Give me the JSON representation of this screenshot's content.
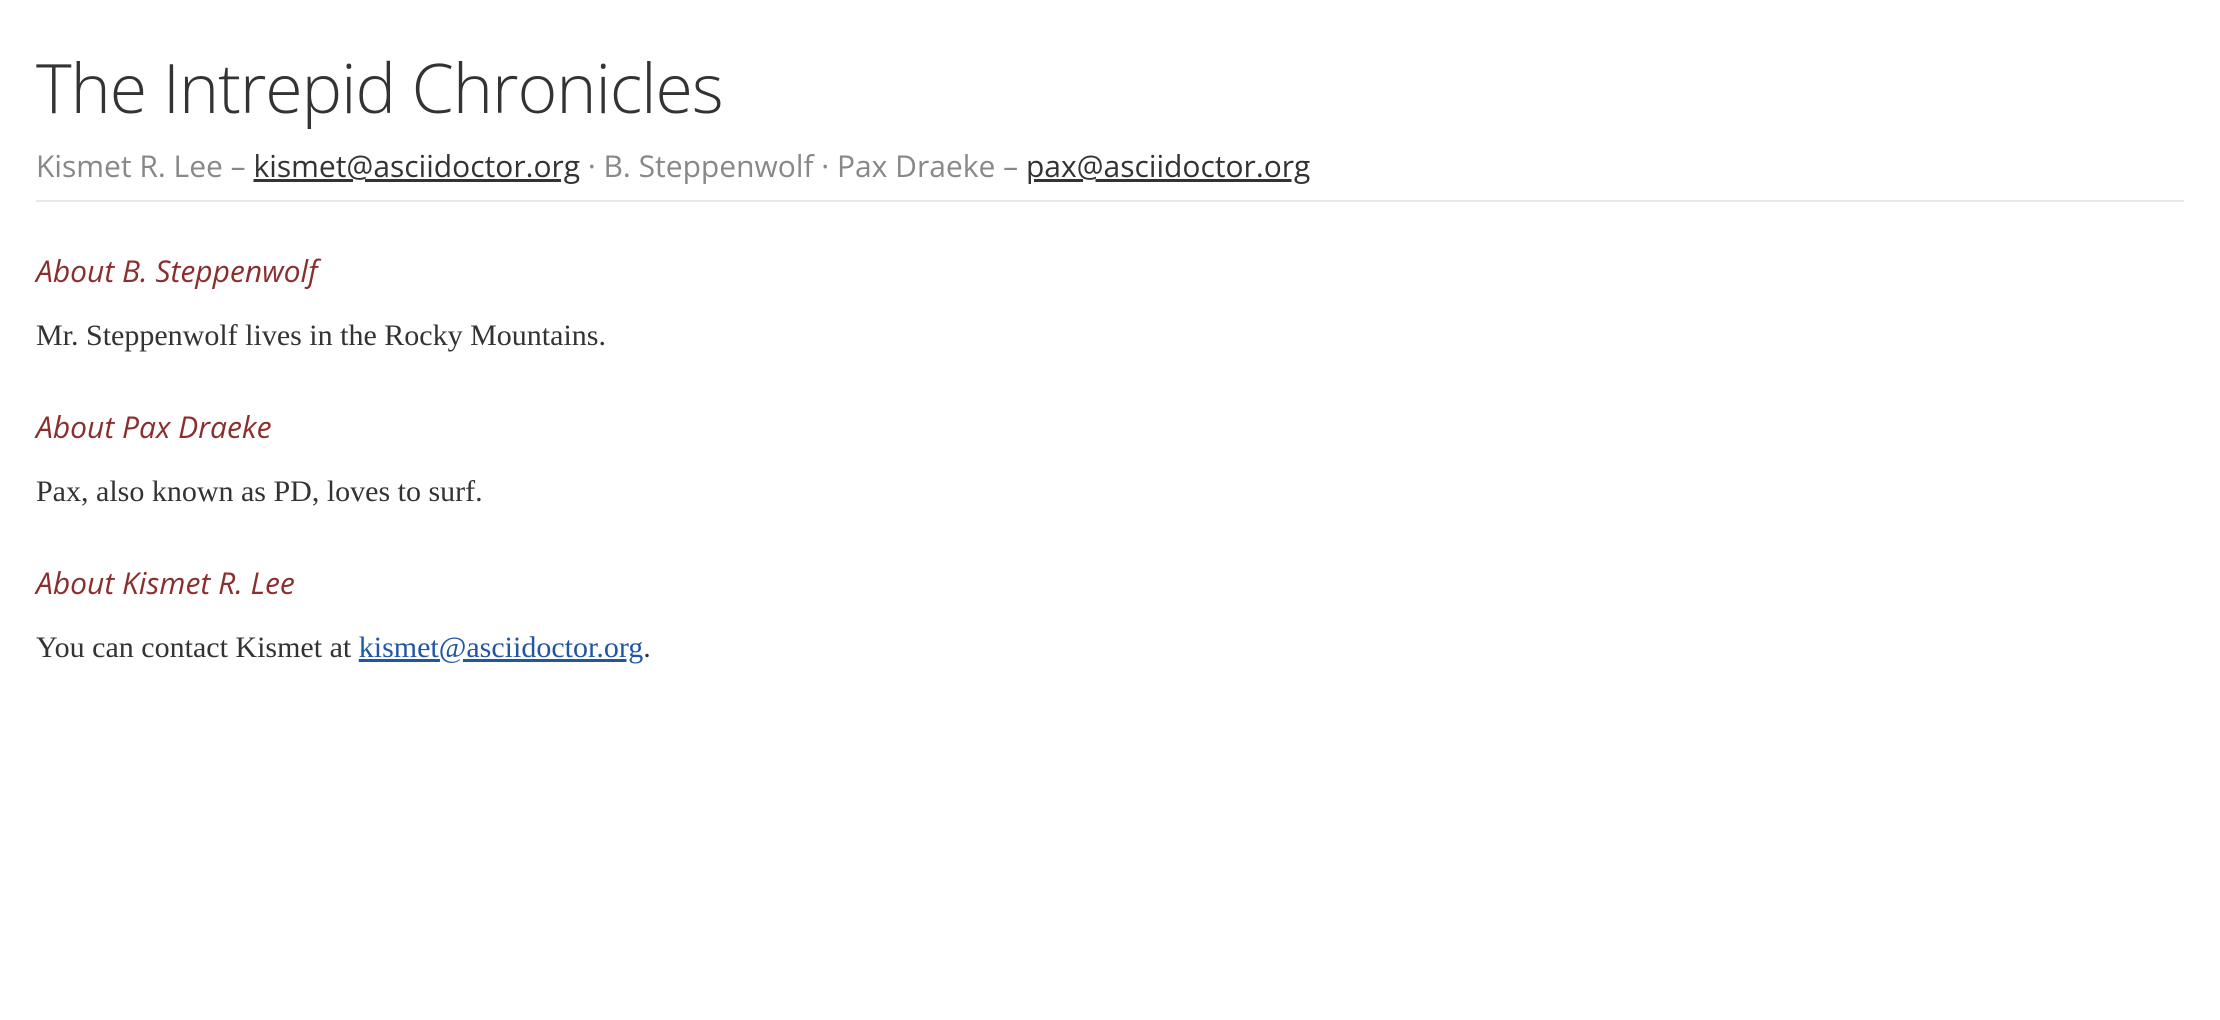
{
  "title": "The Intrepid Chronicles",
  "authors": {
    "a1_name": "Kismet R. Lee",
    "a1_email": "kismet@asciidoctor.org",
    "a2_name": "B. Steppenwolf",
    "a3_name": "Pax Draeke",
    "a3_email": "pax@asciidoctor.org",
    "sep_dash": " – ",
    "sep_dot": " · "
  },
  "sections": {
    "s1": {
      "title": "About B. Steppenwolf",
      "body": "Mr. Steppenwolf lives in the Rocky Mountains."
    },
    "s2": {
      "title": "About Pax Draeke",
      "body": "Pax, also known as PD, loves to surf."
    },
    "s3": {
      "title": "About Kismet R. Lee",
      "body_prefix": "You can contact Kismet at ",
      "body_link": "kismet@asciidoctor.org",
      "body_suffix": "."
    }
  }
}
